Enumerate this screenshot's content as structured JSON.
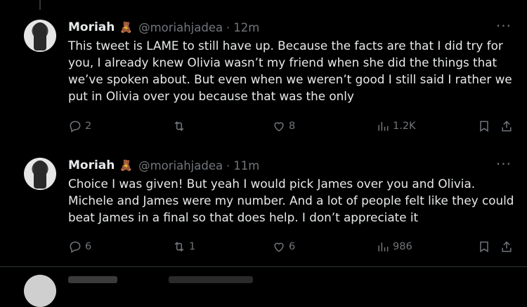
{
  "tweets": [
    {
      "name": "Moriah",
      "badge_icon": "teddy-bear-icon",
      "handle": "@moriahjadea",
      "separator": "·",
      "time": "12m",
      "more": "···",
      "text": "This tweet is LAME to still have up. Because the facts are that I did try for you, I already knew Olivia wasn’t my friend when she did the things that we’ve spoken about. But even when we weren’t good I still said I rather we put in Olivia over you because that was the only",
      "replies": "2",
      "retweets": "",
      "likes": "8",
      "views": "1.2K"
    },
    {
      "name": "Moriah",
      "badge_icon": "teddy-bear-icon",
      "handle": "@moriahjadea",
      "separator": "·",
      "time": "11m",
      "more": "···",
      "text": "Choice I was given! But yeah I would pick James over you and Olivia. Michele and James were my number. And a lot of people felt like they could beat James in a final so that does help. I don’t appreciate it",
      "replies": "6",
      "retweets": "1",
      "likes": "6",
      "views": "986"
    }
  ],
  "colors": {
    "background": "#000000",
    "text": "#e7e9ea",
    "muted": "#71767b",
    "divider": "#2f3336"
  }
}
